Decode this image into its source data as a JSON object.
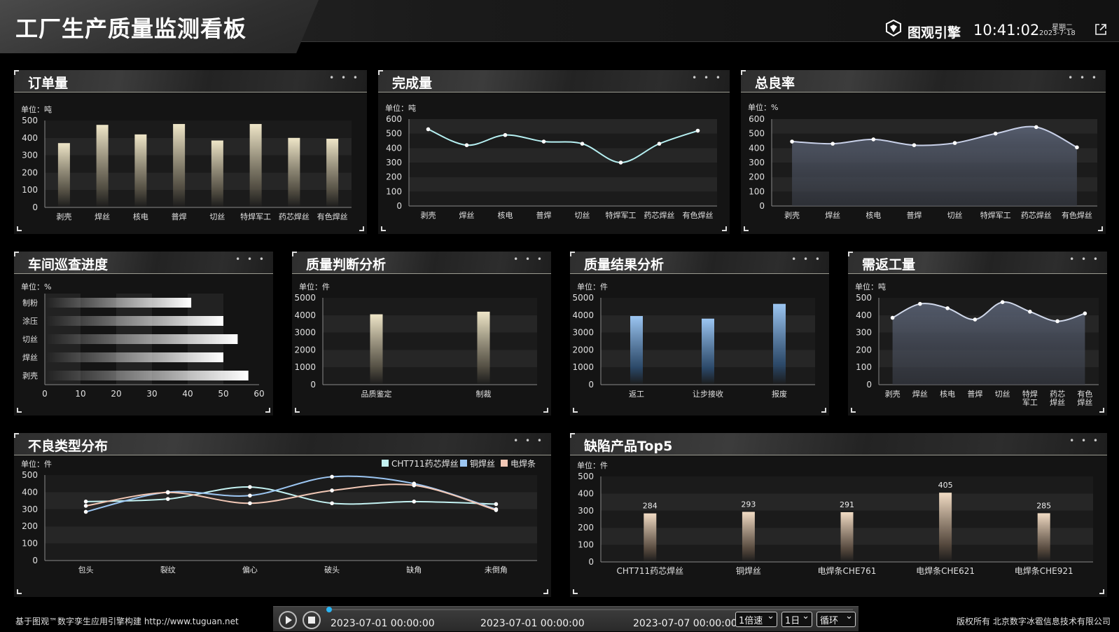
{
  "header": {
    "title": "工厂生产质量监测看板",
    "brand": "图观引擎",
    "time": "10:41:02",
    "weekday": "星期二",
    "date": "2023-7-18"
  },
  "panels": {
    "orders": {
      "title": "订单量",
      "unit": "单位：吨"
    },
    "completed": {
      "title": "完成量",
      "unit": "单位：吨"
    },
    "yield": {
      "title": "总良率",
      "unit": "单位：%"
    },
    "patrol": {
      "title": "车间巡查进度",
      "unit": "单位：%"
    },
    "judgement": {
      "title": "质量判断分析",
      "unit": "单位：件"
    },
    "result": {
      "title": "质量结果分析",
      "unit": "单位：件"
    },
    "rework": {
      "title": "需返工量",
      "unit": "单位：吨"
    },
    "defect_types": {
      "title": "不良类型分布",
      "unit": "单位：件"
    },
    "top5": {
      "title": "缺陷产品Top5",
      "unit": "单位：件"
    }
  },
  "chart_data": [
    {
      "id": "orders",
      "type": "bar",
      "categories": [
        "剥壳",
        "焊丝",
        "核电",
        "普焊",
        "切丝",
        "特焊军工",
        "药芯焊丝",
        "有色焊丝"
      ],
      "values": [
        370,
        475,
        420,
        480,
        385,
        480,
        400,
        395
      ],
      "ylim": [
        0,
        500
      ],
      "yticks": [
        0,
        100,
        200,
        300,
        400,
        500
      ],
      "colors": [
        "#efe6c8",
        "#5a5548"
      ]
    },
    {
      "id": "completed",
      "type": "line",
      "categories": [
        "剥壳",
        "焊丝",
        "核电",
        "普焊",
        "切丝",
        "特焊军工",
        "药芯焊丝",
        "有色焊丝"
      ],
      "values": [
        530,
        420,
        490,
        445,
        430,
        300,
        430,
        520
      ],
      "ylim": [
        0,
        600
      ],
      "yticks": [
        0,
        100,
        200,
        300,
        400,
        500,
        600
      ],
      "colors": [
        "#b6f0f2"
      ]
    },
    {
      "id": "yield",
      "type": "area",
      "categories": [
        "剥壳",
        "焊丝",
        "核电",
        "普焊",
        "切丝",
        "特焊军工",
        "药芯焊丝",
        "有色焊丝"
      ],
      "values": [
        445,
        430,
        460,
        420,
        435,
        500,
        545,
        405
      ],
      "ylim": [
        0,
        600
      ],
      "yticks": [
        0,
        100,
        200,
        300,
        400,
        500,
        600
      ],
      "colors": [
        "#c8d0e8"
      ]
    },
    {
      "id": "patrol",
      "type": "bar",
      "orientation": "horizontal",
      "categories": [
        "剥壳",
        "焊丝",
        "切丝",
        "涂压",
        "制粉"
      ],
      "values": [
        57,
        50,
        54,
        50,
        41
      ],
      "xlim": [
        0,
        60
      ],
      "xticks": [
        0,
        10,
        20,
        30,
        40,
        50,
        60
      ],
      "colors": [
        "#ffffff"
      ]
    },
    {
      "id": "judgement",
      "type": "bar",
      "categories": [
        "品质鉴定",
        "制裁"
      ],
      "values": [
        4050,
        4200
      ],
      "ylim": [
        0,
        5000
      ],
      "yticks": [
        0,
        1000,
        2000,
        3000,
        4000,
        5000
      ],
      "colors": [
        "#efe6c8",
        "#5a5548"
      ]
    },
    {
      "id": "result",
      "type": "bar",
      "categories": [
        "返工",
        "让步接收",
        "报废"
      ],
      "values": [
        3950,
        3800,
        4650
      ],
      "ylim": [
        0,
        5000
      ],
      "yticks": [
        0,
        1000,
        2000,
        3000,
        4000,
        5000
      ],
      "colors": [
        "#9cc6f2",
        "#2d4d70"
      ]
    },
    {
      "id": "rework",
      "type": "area",
      "categories": [
        "剥壳",
        "焊丝",
        "核电",
        "普焊",
        "切丝",
        "特焊军工",
        "药芯焊丝",
        "有色焊丝"
      ],
      "values": [
        385,
        465,
        440,
        375,
        475,
        420,
        365,
        410
      ],
      "ylim": [
        0,
        500
      ],
      "yticks": [
        0,
        100,
        200,
        300,
        400,
        500
      ],
      "colors": [
        "#d0d8ea"
      ]
    },
    {
      "id": "defect_types",
      "type": "line",
      "categories": [
        "包头",
        "裂纹",
        "偏心",
        "破头",
        "缺角",
        "未倒角"
      ],
      "series": [
        {
          "name": "CHT711药芯焊丝",
          "values": [
            345,
            360,
            430,
            335,
            345,
            330
          ]
        },
        {
          "name": "铜焊丝",
          "values": [
            285,
            400,
            380,
            490,
            450,
            300
          ]
        },
        {
          "name": "电焊条",
          "values": [
            320,
            398,
            335,
            410,
            440,
            295
          ]
        }
      ],
      "ylim": [
        0,
        500
      ],
      "yticks": [
        0,
        100,
        200,
        300,
        400,
        500
      ],
      "colors": [
        "#c4f2f2",
        "#9cc6f2",
        "#f2c8b6"
      ],
      "legend": "top-right"
    },
    {
      "id": "top5",
      "type": "bar",
      "categories": [
        "CHT711药芯焊丝",
        "铜焊丝",
        "电焊条CHE761",
        "电焊条CHE621",
        "电焊条CHE921"
      ],
      "values": [
        284,
        293,
        291,
        405,
        285
      ],
      "ylim": [
        0,
        500
      ],
      "yticks": [
        0,
        100,
        200,
        300,
        400,
        500
      ],
      "data_labels": true,
      "colors": [
        "#f2dcc4",
        "#5a4c40"
      ]
    }
  ],
  "player": {
    "time_current": "2023-07-01 00:00:00",
    "time_start": "2023-07-01 00:00:00",
    "time_end": "2023-07-07 00:00:00",
    "speed": "1倍速",
    "step": "1日",
    "mode": "循环"
  },
  "footer": {
    "left": "基于图观™数字孪生应用引擎构建 http://www.tuguan.net",
    "right": "版权所有 北京数字冰雹信息技术有限公司"
  }
}
